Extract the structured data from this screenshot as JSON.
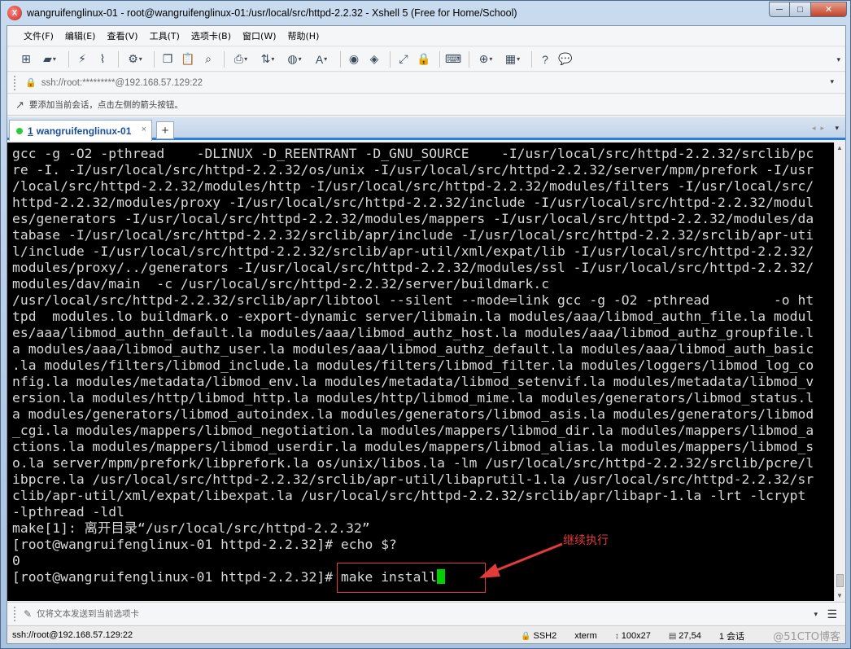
{
  "window": {
    "title": "wangruifenglinux-01 - root@wangruifenglinux-01:/usr/local/src/httpd-2.2.32 - Xshell 5 (Free for Home/School)"
  },
  "menu": [
    "文件(F)",
    "编辑(E)",
    "查看(V)",
    "工具(T)",
    "选项卡(B)",
    "窗口(W)",
    "帮助(H)"
  ],
  "address": {
    "value": "ssh://root:*********@192.168.57.129:22"
  },
  "hint": {
    "text": "要添加当前会话，点击左侧的箭头按钮。"
  },
  "tab": {
    "number": "1",
    "label": "wangruifenglinux-01",
    "close": "×",
    "add": "+"
  },
  "terminal": {
    "lines": [
      "gcc -g -O2 -pthread    -DLINUX -D_REENTRANT -D_GNU_SOURCE    -I/usr/local/src/httpd-2.2.32/srclib/pc",
      "re -I. -I/usr/local/src/httpd-2.2.32/os/unix -I/usr/local/src/httpd-2.2.32/server/mpm/prefork -I/usr",
      "/local/src/httpd-2.2.32/modules/http -I/usr/local/src/httpd-2.2.32/modules/filters -I/usr/local/src/",
      "httpd-2.2.32/modules/proxy -I/usr/local/src/httpd-2.2.32/include -I/usr/local/src/httpd-2.2.32/modul",
      "es/generators -I/usr/local/src/httpd-2.2.32/modules/mappers -I/usr/local/src/httpd-2.2.32/modules/da",
      "tabase -I/usr/local/src/httpd-2.2.32/srclib/apr/include -I/usr/local/src/httpd-2.2.32/srclib/apr-uti",
      "l/include -I/usr/local/src/httpd-2.2.32/srclib/apr-util/xml/expat/lib -I/usr/local/src/httpd-2.2.32/",
      "modules/proxy/../generators -I/usr/local/src/httpd-2.2.32/modules/ssl -I/usr/local/src/httpd-2.2.32/",
      "modules/dav/main  -c /usr/local/src/httpd-2.2.32/server/buildmark.c",
      "/usr/local/src/httpd-2.2.32/srclib/apr/libtool --silent --mode=link gcc -g -O2 -pthread        -o ht",
      "tpd  modules.lo buildmark.o -export-dynamic server/libmain.la modules/aaa/libmod_authn_file.la modul",
      "es/aaa/libmod_authn_default.la modules/aaa/libmod_authz_host.la modules/aaa/libmod_authz_groupfile.l",
      "a modules/aaa/libmod_authz_user.la modules/aaa/libmod_authz_default.la modules/aaa/libmod_auth_basic",
      ".la modules/filters/libmod_include.la modules/filters/libmod_filter.la modules/loggers/libmod_log_co",
      "nfig.la modules/metadata/libmod_env.la modules/metadata/libmod_setenvif.la modules/metadata/libmod_v",
      "ersion.la modules/http/libmod_http.la modules/http/libmod_mime.la modules/generators/libmod_status.l",
      "a modules/generators/libmod_autoindex.la modules/generators/libmod_asis.la modules/generators/libmod",
      "_cgi.la modules/mappers/libmod_negotiation.la modules/mappers/libmod_dir.la modules/mappers/libmod_a",
      "ctions.la modules/mappers/libmod_userdir.la modules/mappers/libmod_alias.la modules/mappers/libmod_s",
      "o.la server/mpm/prefork/libprefork.la os/unix/libos.la -lm /usr/local/src/httpd-2.2.32/srclib/pcre/l",
      "ibpcre.la /usr/local/src/httpd-2.2.32/srclib/apr-util/libaprutil-1.la /usr/local/src/httpd-2.2.32/sr",
      "clib/apr-util/xml/expat/libexpat.la /usr/local/src/httpd-2.2.32/srclib/apr/libapr-1.la -lrt -lcrypt",
      "-lpthread -ldl",
      "make[1]: 离开目录“/usr/local/src/httpd-2.2.32”",
      "[root@wangruifenglinux-01 httpd-2.2.32]# echo $?",
      "0"
    ],
    "prompt": "[root@wangruifenglinux-01 httpd-2.2.32]# ",
    "command": "make install",
    "cursor_color": "#00d000"
  },
  "annotation": {
    "label": "继续执行",
    "color": "#e23b3b"
  },
  "sendbar": {
    "placeholder": "仅将文本发送到当前选项卡"
  },
  "status": {
    "connection": "ssh://root@192.168.57.129:22",
    "protocol": "SSH2",
    "terminal_type": "xterm",
    "size": "100x27",
    "cursor_pos": "27,54",
    "sessions": "1 会话",
    "watermark": "@51CTO博客"
  }
}
